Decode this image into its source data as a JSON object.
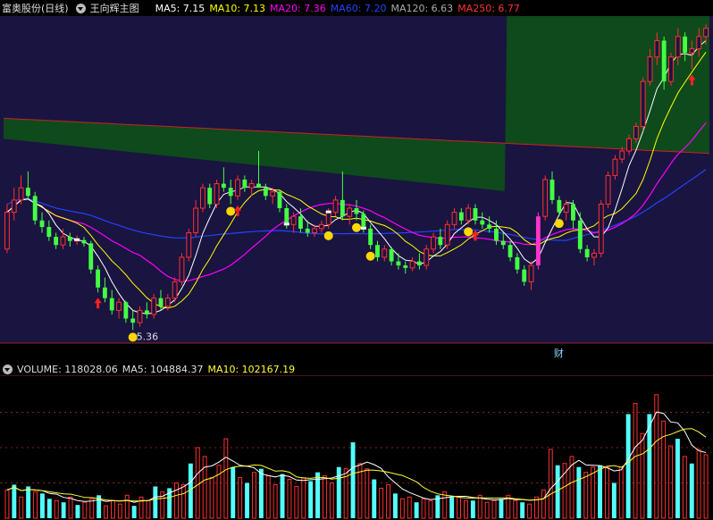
{
  "header": {
    "stock_name": "富奥股份(日线)",
    "indicator_name": "王向辉主图",
    "ma": [
      {
        "label": "MA5: 7.15",
        "color": "#ffffff"
      },
      {
        "label": "MA10: 7.13",
        "color": "#ffff00"
      },
      {
        "label": "MA20: 7.36",
        "color": "#ff00ff"
      },
      {
        "label": "MA60: 7.20",
        "color": "#2244ff"
      },
      {
        "label": "MA120: 6.63",
        "color": "#aaaaaa"
      },
      {
        "label": "MA250: 6.77",
        "color": "#ff3333"
      }
    ]
  },
  "low_label": "5.36",
  "cai_label": "财",
  "volume_header": {
    "volume": "VOLUME: 118028.06",
    "ma5": "MA5: 104884.37",
    "ma10": "MA10: 102167.19"
  },
  "colors": {
    "up": "#ff3030",
    "down": "#54ffff",
    "background": "#000000",
    "price_bg": "#1a1440",
    "band": "#0e4d1a",
    "signal_dot": "#ffd700",
    "signal_arrow": "#ff2020",
    "magenta_bar": "#ff33cc"
  },
  "chart_data": [
    {
      "type": "candlestick",
      "title": "富奥股份(日线)",
      "ylim": [
        5.2,
        9.2
      ],
      "xlim": [
        0,
        110
      ],
      "candles": [
        [
          6.35,
          6.9,
          6.3,
          6.8
        ],
        [
          6.8,
          7.1,
          6.7,
          6.95
        ],
        [
          6.95,
          7.25,
          6.9,
          7.1
        ],
        [
          7.1,
          7.3,
          6.95,
          7.0
        ],
        [
          7.0,
          7.05,
          6.65,
          6.7
        ],
        [
          6.7,
          6.8,
          6.55,
          6.62
        ],
        [
          6.62,
          6.7,
          6.45,
          6.5
        ],
        [
          6.5,
          6.55,
          6.35,
          6.4
        ],
        [
          6.4,
          6.6,
          6.35,
          6.5
        ],
        [
          6.5,
          6.55,
          6.38,
          6.45
        ],
        [
          6.45,
          6.52,
          6.4,
          6.46
        ],
        [
          6.46,
          6.5,
          6.38,
          6.42
        ],
        [
          6.42,
          6.45,
          6.05,
          6.1
        ],
        [
          6.1,
          6.15,
          5.82,
          5.88
        ],
        [
          5.88,
          6.0,
          5.7,
          5.75
        ],
        [
          5.75,
          5.85,
          5.55,
          5.6
        ],
        [
          5.6,
          5.75,
          5.5,
          5.7
        ],
        [
          5.7,
          5.72,
          5.45,
          5.5
        ],
        [
          5.5,
          5.6,
          5.36,
          5.45
        ],
        [
          5.45,
          5.65,
          5.4,
          5.6
        ],
        [
          5.6,
          5.7,
          5.5,
          5.55
        ],
        [
          5.55,
          5.8,
          5.5,
          5.75
        ],
        [
          5.75,
          5.85,
          5.6,
          5.65
        ],
        [
          5.65,
          5.8,
          5.6,
          5.75
        ],
        [
          5.75,
          6.0,
          5.7,
          5.95
        ],
        [
          5.95,
          6.3,
          5.9,
          6.25
        ],
        [
          6.25,
          6.6,
          6.2,
          6.55
        ],
        [
          6.55,
          6.95,
          6.5,
          6.85
        ],
        [
          6.85,
          7.15,
          6.8,
          7.1
        ],
        [
          7.1,
          7.15,
          6.85,
          6.9
        ],
        [
          6.9,
          7.2,
          6.85,
          7.15
        ],
        [
          7.15,
          7.35,
          7.05,
          7.1
        ],
        [
          7.1,
          7.2,
          6.9,
          7.0
        ],
        [
          7.0,
          7.25,
          6.95,
          7.2
        ],
        [
          7.2,
          7.25,
          7.05,
          7.1
        ],
        [
          7.1,
          7.2,
          7.0,
          7.15
        ],
        [
          7.15,
          7.55,
          7.1,
          7.1
        ],
        [
          7.1,
          7.15,
          6.95,
          7.0
        ],
        [
          7.0,
          7.1,
          6.9,
          7.05
        ],
        [
          7.05,
          7.08,
          6.8,
          6.85
        ],
        [
          6.85,
          6.9,
          6.6,
          6.65
        ],
        [
          6.65,
          6.8,
          6.55,
          6.75
        ],
        [
          6.75,
          6.85,
          6.55,
          6.6
        ],
        [
          6.6,
          6.7,
          6.5,
          6.55
        ],
        [
          6.55,
          6.65,
          6.5,
          6.6
        ],
        [
          6.6,
          6.7,
          6.55,
          6.65
        ],
        [
          6.65,
          6.85,
          6.6,
          6.8
        ],
        [
          6.8,
          7.0,
          6.75,
          6.95
        ],
        [
          6.95,
          7.3,
          6.7,
          6.75
        ],
        [
          6.75,
          6.9,
          6.65,
          6.85
        ],
        [
          6.85,
          6.95,
          6.7,
          6.78
        ],
        [
          6.78,
          6.82,
          6.55,
          6.6
        ],
        [
          6.6,
          6.65,
          6.35,
          6.4
        ],
        [
          6.4,
          6.45,
          6.2,
          6.25
        ],
        [
          6.25,
          6.4,
          6.2,
          6.35
        ],
        [
          6.35,
          6.38,
          6.15,
          6.2
        ],
        [
          6.2,
          6.3,
          6.1,
          6.15
        ],
        [
          6.15,
          6.2,
          6.05,
          6.12
        ],
        [
          6.12,
          6.25,
          6.08,
          6.2
        ],
        [
          6.2,
          6.3,
          6.1,
          6.15
        ],
        [
          6.15,
          6.4,
          6.1,
          6.35
        ],
        [
          6.35,
          6.55,
          6.3,
          6.5
        ],
        [
          6.5,
          6.6,
          6.35,
          6.4
        ],
        [
          6.4,
          6.7,
          6.35,
          6.65
        ],
        [
          6.65,
          6.85,
          6.6,
          6.8
        ],
        [
          6.8,
          6.85,
          6.65,
          6.7
        ],
        [
          6.7,
          6.9,
          6.65,
          6.85
        ],
        [
          6.85,
          6.9,
          6.65,
          6.7
        ],
        [
          6.7,
          6.8,
          6.6,
          6.65
        ],
        [
          6.65,
          6.75,
          6.55,
          6.6
        ],
        [
          6.6,
          6.7,
          6.4,
          6.45
        ],
        [
          6.45,
          6.55,
          6.35,
          6.4
        ],
        [
          6.4,
          6.45,
          6.2,
          6.25
        ],
        [
          6.25,
          6.3,
          6.05,
          6.1
        ],
        [
          6.1,
          6.15,
          5.9,
          5.95
        ],
        [
          5.95,
          6.2,
          5.85,
          6.15
        ],
        [
          6.15,
          6.8,
          6.1,
          6.75
        ],
        [
          6.75,
          7.25,
          6.7,
          7.2
        ],
        [
          7.2,
          7.3,
          6.9,
          6.95
        ],
        [
          6.95,
          7.0,
          6.75,
          6.8
        ],
        [
          6.8,
          6.95,
          6.7,
          6.9
        ],
        [
          6.9,
          6.95,
          6.6,
          6.7
        ],
        [
          6.7,
          6.8,
          6.3,
          6.35
        ],
        [
          6.35,
          6.4,
          6.2,
          6.25
        ],
        [
          6.25,
          6.35,
          6.15,
          6.3
        ],
        [
          6.3,
          6.95,
          6.25,
          6.9
        ],
        [
          6.9,
          7.3,
          6.85,
          7.25
        ],
        [
          7.25,
          7.5,
          7.2,
          7.45
        ],
        [
          7.45,
          7.6,
          7.4,
          7.55
        ],
        [
          7.55,
          7.75,
          7.5,
          7.7
        ],
        [
          7.7,
          7.9,
          7.65,
          7.85
        ],
        [
          7.85,
          8.45,
          7.8,
          8.4
        ],
        [
          8.4,
          8.8,
          8.35,
          8.7
        ],
        [
          8.7,
          9.0,
          8.6,
          8.9
        ],
        [
          8.9,
          8.95,
          8.3,
          8.4
        ],
        [
          8.4,
          8.75,
          8.35,
          8.7
        ],
        [
          8.7,
          9.05,
          8.6,
          8.95
        ],
        [
          8.95,
          9.0,
          8.65,
          8.75
        ],
        [
          8.75,
          8.9,
          8.55,
          8.8
        ],
        [
          8.8,
          9.05,
          8.7,
          8.95
        ],
        [
          8.95,
          9.1,
          8.85,
          9.05
        ]
      ],
      "bands": [
        {
          "name": "",
          "upper": [
            7.95,
            7.65
          ],
          "lower": [
            7.7,
            7.0
          ],
          "upper_end": [
            7.95,
            7.52
          ],
          "lower_end": [
            7.7,
            7.0
          ]
        }
      ],
      "signals": {
        "arrows": [
          13,
          33,
          98,
          67
        ],
        "dots": [
          18,
          32,
          46,
          50,
          52,
          66,
          79
        ],
        "white_marks": [
          10,
          40,
          46,
          51
        ],
        "magenta_index": 76
      },
      "low_marker_index": 18
    },
    {
      "type": "bar",
      "title": "VOLUME",
      "ylim": [
        0,
        160000
      ],
      "values": [
        32000,
        38000,
        24000,
        36000,
        30000,
        28000,
        22000,
        20000,
        18000,
        24000,
        15000,
        18000,
        22000,
        26000,
        14000,
        20000,
        16000,
        26000,
        14000,
        24000,
        20000,
        36000,
        30000,
        34000,
        40000,
        38000,
        62000,
        80000,
        70000,
        46000,
        60000,
        90000,
        58000,
        46000,
        40000,
        52000,
        56000,
        48000,
        38000,
        50000,
        44000,
        36000,
        46000,
        42000,
        52000,
        48000,
        40000,
        58000,
        56000,
        86000,
        62000,
        56000,
        44000,
        34000,
        38000,
        28000,
        22000,
        24000,
        18000,
        22000,
        20000,
        26000,
        30000,
        24000,
        24000,
        20000,
        20000,
        26000,
        18000,
        20000,
        22000,
        26000,
        20000,
        18000,
        16000,
        24000,
        32000,
        78000,
        60000,
        62000,
        70000,
        58000,
        52000,
        58000,
        60000,
        58000,
        40000,
        58000,
        118000,
        130000,
        96000,
        118000,
        140000,
        110000,
        82000,
        90000,
        70000,
        62000,
        78000,
        72000
      ],
      "down_indices": [
        1,
        3,
        5,
        6,
        8,
        10,
        13,
        18,
        21,
        23,
        26,
        32,
        34,
        36,
        39,
        43,
        44,
        47,
        49,
        52,
        55,
        58,
        61,
        63,
        66,
        70,
        73,
        78,
        81,
        84,
        86,
        88,
        91,
        95,
        97
      ]
    }
  ]
}
